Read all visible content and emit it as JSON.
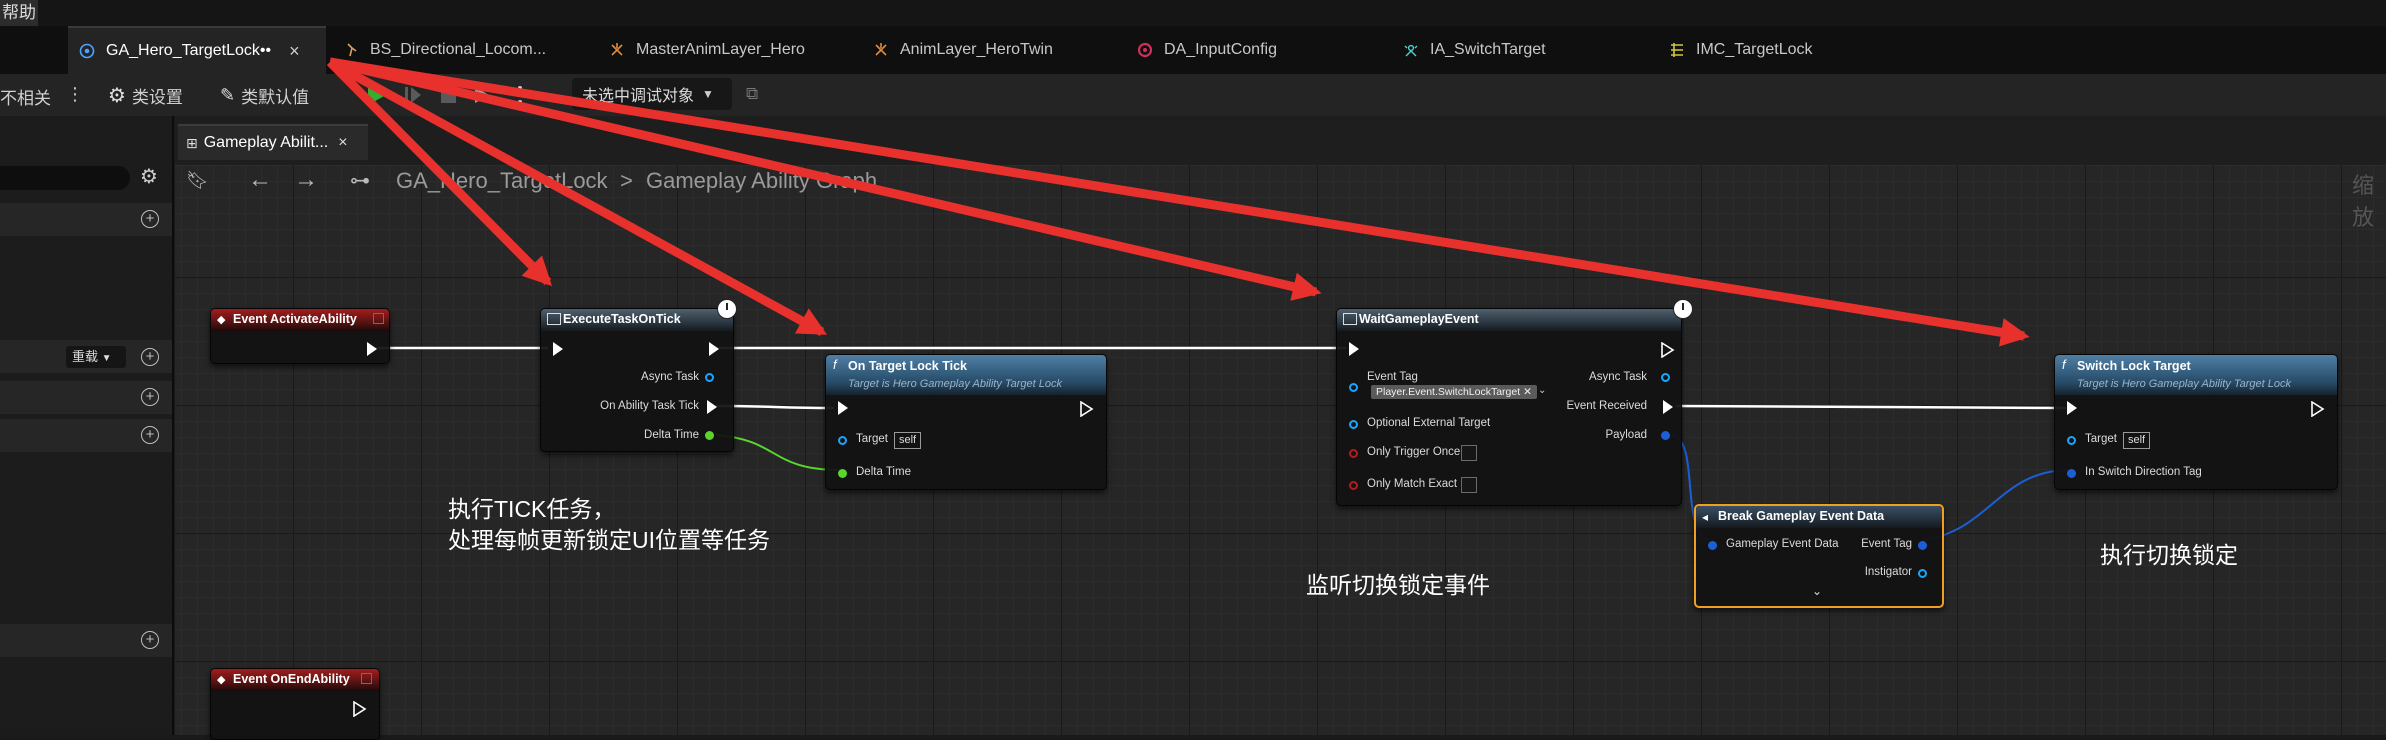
{
  "menu": {
    "help_fragment": "帮助"
  },
  "tabs": [
    {
      "label": "GA_Hero_TargetLock••",
      "close": "×",
      "icon": "blueprint-icon"
    },
    {
      "label": "BS_Directional_Locom...",
      "icon": "blendspace-icon"
    },
    {
      "label": "MasterAnimLayer_Hero",
      "icon": "anim-layer-icon"
    },
    {
      "label": "AnimLayer_HeroTwin",
      "icon": "anim-layer-icon"
    },
    {
      "label": "DA_InputConfig",
      "icon": "data-asset-icon"
    },
    {
      "label": "IA_SwitchTarget",
      "icon": "input-action-icon"
    },
    {
      "label": "IMC_TargetLock",
      "icon": "mapping-context-icon"
    }
  ],
  "toolbar": {
    "irrelevant_fragment": "不相关",
    "class_settings": "类设置",
    "class_defaults": "类默认值",
    "debug_object": "未选中调试对象"
  },
  "graph": {
    "tab_label": "Gameplay Abilit...",
    "tab_close": "×",
    "breadcrumb_asset": "GA_Hero_TargetLock",
    "breadcrumb_sep": ">",
    "breadcrumb_graph": "Gameplay Ability Graph",
    "zoom_fragment": "缩放"
  },
  "left_panel": {
    "override_label": "重载"
  },
  "nodes": {
    "event_activate": {
      "title": "Event ActivateAbility"
    },
    "execute_task": {
      "title": "ExecuteTaskOnTick",
      "pin_async": "Async Task",
      "pin_tick": "On Ability Task Tick",
      "pin_delta": "Delta Time"
    },
    "on_target_tick": {
      "title": "On Target Lock Tick",
      "subtitle": "Target is Hero Gameplay Ability Target Lock",
      "pin_target": "Target",
      "self": "self",
      "pin_delta": "Delta Time"
    },
    "wait_event": {
      "title": "WaitGameplayEvent",
      "pin_event_tag": "Event Tag",
      "tag_value": "Player.Event.SwitchLockTarget",
      "pin_optional": "Optional External Target",
      "pin_once": "Only Trigger Once",
      "pin_exact": "Only Match Exact",
      "pin_async": "Async Task",
      "pin_received": "Event Received",
      "pin_payload": "Payload"
    },
    "break_event": {
      "title": "Break Gameplay Event Data",
      "pin_data": "Gameplay Event Data",
      "pin_tag": "Event Tag",
      "pin_instigator": "Instigator"
    },
    "switch_target": {
      "title": "Switch Lock Target",
      "subtitle": "Target is Hero Gameplay Ability Target Lock",
      "pin_target": "Target",
      "self": "self",
      "pin_dir": "In Switch Direction Tag"
    },
    "event_end": {
      "title": "Event OnEndAbility"
    }
  },
  "comments": {
    "tick_line1": "执行TICK任务，",
    "tick_line2": "处理每帧更新锁定UI位置等任务",
    "listen": "监听切换锁定事件",
    "switch": "执行切换锁定"
  },
  "colors": {
    "arrow": "#e8302c",
    "exec_wire": "#ffffff",
    "float_wire": "#5ad52a",
    "struct_wire": "#1b5fd6",
    "selected": "#f0a020"
  }
}
